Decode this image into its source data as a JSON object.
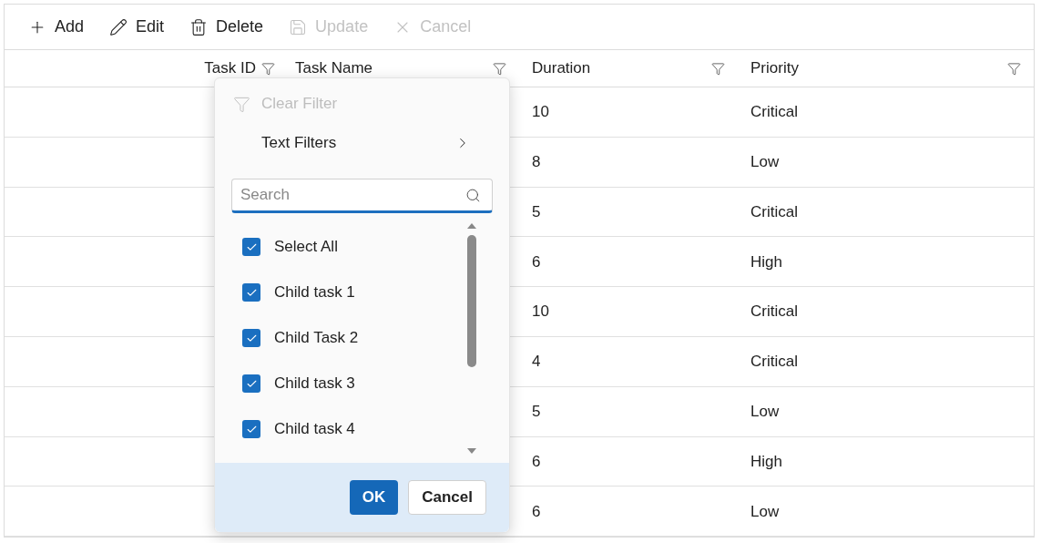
{
  "toolbar": [
    {
      "kind": "add",
      "label": "Add",
      "disabled": false
    },
    {
      "kind": "edit",
      "label": "Edit",
      "disabled": false
    },
    {
      "kind": "delete",
      "label": "Delete",
      "disabled": false
    },
    {
      "kind": "update",
      "label": "Update",
      "disabled": true
    },
    {
      "kind": "cancel",
      "label": "Cancel",
      "disabled": true
    }
  ],
  "columns": [
    {
      "label": "Task ID"
    },
    {
      "label": "Task Name"
    },
    {
      "label": "Duration"
    },
    {
      "label": "Priority"
    }
  ],
  "rows": [
    {
      "duration": "10",
      "priority": "Critical"
    },
    {
      "duration": "8",
      "priority": "Low"
    },
    {
      "duration": "5",
      "priority": "Critical"
    },
    {
      "duration": "6",
      "priority": "High"
    },
    {
      "duration": "10",
      "priority": "Critical"
    },
    {
      "duration": "4",
      "priority": "Critical"
    },
    {
      "duration": "5",
      "priority": "Low"
    },
    {
      "duration": "6",
      "priority": "High"
    },
    {
      "duration": "6",
      "priority": "Low"
    }
  ],
  "filter_menu": {
    "clear_filter": {
      "label": "Clear Filter",
      "disabled": true
    },
    "text_filters": "Text Filters",
    "search": {
      "placeholder": "Search"
    },
    "items": [
      {
        "label": "Select All",
        "checked": true
      },
      {
        "label": "Child task 1",
        "checked": true
      },
      {
        "label": "Child Task 2",
        "checked": true
      },
      {
        "label": "Child task 3",
        "checked": true
      },
      {
        "label": "Child task 4",
        "checked": true
      }
    ],
    "buttons": [
      "OK",
      "Cancel"
    ]
  }
}
